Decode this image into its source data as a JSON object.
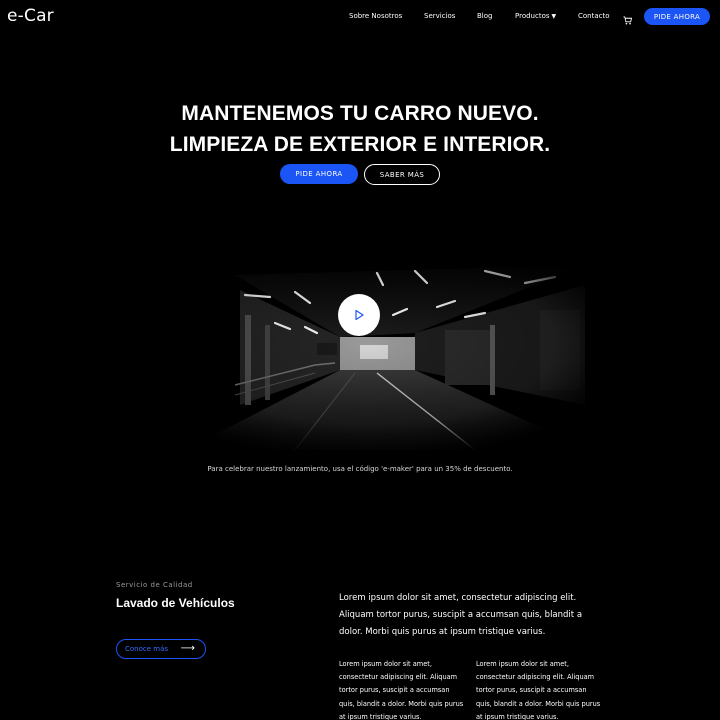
{
  "brand": {
    "logo": "e-Car",
    "accent": "#1b55f5"
  },
  "nav": {
    "items": [
      {
        "label": "Sobre Nosotros"
      },
      {
        "label": "Servicios"
      },
      {
        "label": "Blog"
      },
      {
        "label": "Productos",
        "has_dropdown": true
      },
      {
        "label": "Contacto"
      }
    ],
    "cart_icon": "cart-icon",
    "cta_label": "PIDE AHORA"
  },
  "hero": {
    "title_line1": "MANTENEMOS TU CARRO NUEVO.",
    "title_line2": "LIMPIEZA DE EXTERIOR E INTERIOR.",
    "primary_label": "PIDE AHORA",
    "secondary_label": "SABER MÁS"
  },
  "video": {
    "play_icon": "play-icon",
    "promo_text": "Para celebrar nuestro lanzamiento, usa el código 'e-maker' para un 35% de descuento."
  },
  "service": {
    "kicker": "Servicio de Calidad",
    "title": "Lavado de Vehículos",
    "more_label": "Conoce más",
    "lead": "Lorem ipsum dolor sit amet, consectetur adipiscing elit. Aliquam tortor purus, suscipit a accumsan quis, blandit a dolor. Morbi quis purus at ipsum tristique varius.",
    "col1": "Lorem ipsum dolor sit amet, consectetur adipiscing elit. Aliquam tortor purus, suscipit a accumsan quis, blandit a dolor. Morbi quis purus at ipsum tristique varius.",
    "col2": "Lorem ipsum dolor sit amet, consectetur adipiscing elit. Aliquam tortor purus, suscipit a accumsan quis, blandit a dolor. Morbi quis purus at ipsum tristique varius."
  }
}
